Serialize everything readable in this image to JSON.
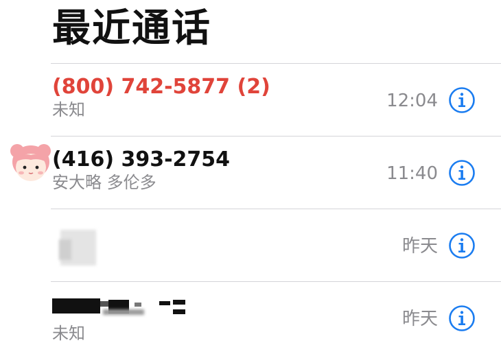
{
  "header": {
    "title": "最近通话"
  },
  "calls": [
    {
      "number": "(800) 742-5877 (2)",
      "label": "未知",
      "time": "12:04",
      "missed": true
    },
    {
      "number": "(416) 393-2754",
      "label": "安大略 多伦多",
      "time": "11:40",
      "missed": false
    },
    {
      "number": "",
      "label": "",
      "time": "昨天",
      "missed": false
    },
    {
      "number": "",
      "label": "未知",
      "time": "昨天",
      "missed": false
    }
  ],
  "colors": {
    "missed": "#e0443a",
    "accent": "#1a7cf0",
    "secondary_text": "#8a8a8e",
    "divider": "#d4d4d8"
  },
  "icons": {
    "info": "info-circle-icon",
    "sticker": "girl-face-sticker-icon"
  }
}
